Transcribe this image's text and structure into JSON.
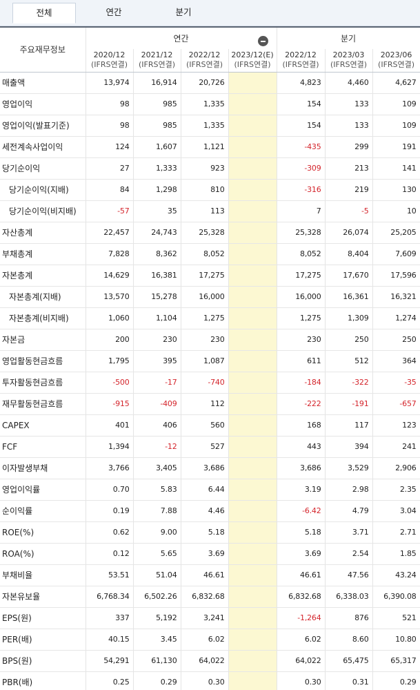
{
  "tabs": [
    {
      "label": "전체",
      "active": true
    },
    {
      "label": "연간",
      "active": false
    },
    {
      "label": "분기",
      "active": false
    }
  ],
  "header": {
    "label_col": "주요재무정보",
    "annual_group": "연간",
    "quarter_group": "분기",
    "collapse_icon": "minus-circle-icon",
    "periods": [
      {
        "date": "2020/12",
        "basis": "(IFRS연결)"
      },
      {
        "date": "2021/12",
        "basis": "(IFRS연결)"
      },
      {
        "date": "2022/12",
        "basis": "(IFRS연결)"
      },
      {
        "date": "2023/12(E)",
        "basis": "(IFRS연결)"
      },
      {
        "date": "2022/12",
        "basis": "(IFRS연결)"
      },
      {
        "date": "2023/03",
        "basis": "(IFRS연결)"
      },
      {
        "date": "2023/06",
        "basis": "(IFRS연결)"
      }
    ]
  },
  "colors": {
    "negative": "#d4242b",
    "estimate_bg": "#fcf8d2"
  },
  "rows": [
    {
      "label": "매출액",
      "sub": false,
      "values": [
        "13,974",
        "16,914",
        "20,726",
        "",
        "4,823",
        "4,460",
        "4,627"
      ]
    },
    {
      "label": "영업이익",
      "sub": false,
      "values": [
        "98",
        "985",
        "1,335",
        "",
        "154",
        "133",
        "109"
      ]
    },
    {
      "label": "영업이익(발표기준)",
      "sub": false,
      "values": [
        "98",
        "985",
        "1,335",
        "",
        "154",
        "133",
        "109"
      ]
    },
    {
      "label": "세전계속사업이익",
      "sub": false,
      "values": [
        "124",
        "1,607",
        "1,121",
        "",
        "-435",
        "299",
        "191"
      ]
    },
    {
      "label": "당기순이익",
      "sub": false,
      "values": [
        "27",
        "1,333",
        "923",
        "",
        "-309",
        "213",
        "141"
      ]
    },
    {
      "label": "당기순이익(지배)",
      "sub": true,
      "values": [
        "84",
        "1,298",
        "810",
        "",
        "-316",
        "219",
        "130"
      ]
    },
    {
      "label": "당기순이익(비지배)",
      "sub": true,
      "values": [
        "-57",
        "35",
        "113",
        "",
        "7",
        "-5",
        "10"
      ]
    },
    {
      "label": "자산총계",
      "sub": false,
      "values": [
        "22,457",
        "24,743",
        "25,328",
        "",
        "25,328",
        "26,074",
        "25,205"
      ]
    },
    {
      "label": "부채총계",
      "sub": false,
      "values": [
        "7,828",
        "8,362",
        "8,052",
        "",
        "8,052",
        "8,404",
        "7,609"
      ]
    },
    {
      "label": "자본총계",
      "sub": false,
      "values": [
        "14,629",
        "16,381",
        "17,275",
        "",
        "17,275",
        "17,670",
        "17,596"
      ]
    },
    {
      "label": "자본총계(지배)",
      "sub": true,
      "values": [
        "13,570",
        "15,278",
        "16,000",
        "",
        "16,000",
        "16,361",
        "16,321"
      ]
    },
    {
      "label": "자본총계(비지배)",
      "sub": true,
      "values": [
        "1,060",
        "1,104",
        "1,275",
        "",
        "1,275",
        "1,309",
        "1,274"
      ]
    },
    {
      "label": "자본금",
      "sub": false,
      "values": [
        "200",
        "230",
        "230",
        "",
        "230",
        "250",
        "250"
      ]
    },
    {
      "label": "영업활동현금흐름",
      "sub": false,
      "values": [
        "1,795",
        "395",
        "1,087",
        "",
        "611",
        "512",
        "364"
      ]
    },
    {
      "label": "투자활동현금흐름",
      "sub": false,
      "values": [
        "-500",
        "-17",
        "-740",
        "",
        "-184",
        "-322",
        "-35"
      ]
    },
    {
      "label": "재무활동현금흐름",
      "sub": false,
      "values": [
        "-915",
        "-409",
        "112",
        "",
        "-222",
        "-191",
        "-657"
      ]
    },
    {
      "label": "CAPEX",
      "sub": false,
      "values": [
        "401",
        "406",
        "560",
        "",
        "168",
        "117",
        "123"
      ]
    },
    {
      "label": "FCF",
      "sub": false,
      "values": [
        "1,394",
        "-12",
        "527",
        "",
        "443",
        "394",
        "241"
      ]
    },
    {
      "label": "이자발생부채",
      "sub": false,
      "values": [
        "3,766",
        "3,405",
        "3,686",
        "",
        "3,686",
        "3,529",
        "2,906"
      ]
    },
    {
      "label": "영업이익률",
      "sub": false,
      "values": [
        "0.70",
        "5.83",
        "6.44",
        "",
        "3.19",
        "2.98",
        "2.35"
      ]
    },
    {
      "label": "순이익률",
      "sub": false,
      "values": [
        "0.19",
        "7.88",
        "4.46",
        "",
        "-6.42",
        "4.79",
        "3.04"
      ]
    },
    {
      "label": "ROE(%)",
      "sub": false,
      "values": [
        "0.62",
        "9.00",
        "5.18",
        "",
        "5.18",
        "3.71",
        "2.71"
      ]
    },
    {
      "label": "ROA(%)",
      "sub": false,
      "values": [
        "0.12",
        "5.65",
        "3.69",
        "",
        "3.69",
        "2.54",
        "1.85"
      ]
    },
    {
      "label": "부채비율",
      "sub": false,
      "values": [
        "53.51",
        "51.04",
        "46.61",
        "",
        "46.61",
        "47.56",
        "43.24"
      ]
    },
    {
      "label": "자본유보율",
      "sub": false,
      "values": [
        "6,768.34",
        "6,502.26",
        "6,832.68",
        "",
        "6,832.68",
        "6,338.03",
        "6,390.08"
      ]
    },
    {
      "label": "EPS(원)",
      "sub": false,
      "values": [
        "337",
        "5,192",
        "3,241",
        "",
        "-1,264",
        "876",
        "521"
      ]
    },
    {
      "label": "PER(배)",
      "sub": false,
      "values": [
        "40.15",
        "3.45",
        "6.02",
        "",
        "6.02",
        "8.60",
        "10.80"
      ]
    },
    {
      "label": "BPS(원)",
      "sub": false,
      "values": [
        "54,291",
        "61,130",
        "64,022",
        "",
        "64,022",
        "65,475",
        "65,317"
      ]
    },
    {
      "label": "PBR(배)",
      "sub": false,
      "values": [
        "0.25",
        "0.29",
        "0.30",
        "",
        "0.30",
        "0.31",
        "0.29"
      ]
    }
  ]
}
